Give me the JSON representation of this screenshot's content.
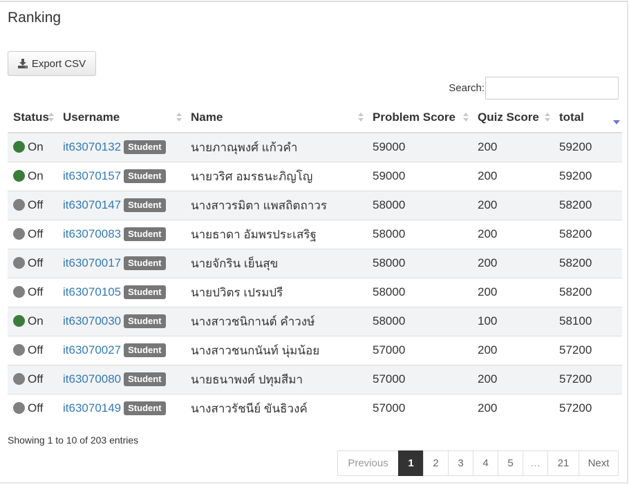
{
  "page": {
    "title": "Ranking",
    "export_label": "Export CSV",
    "search_label": "Search:",
    "search_value": "",
    "info": "Showing 1 to 10 of 203 entries"
  },
  "columns": [
    "Status",
    "Username",
    "Name",
    "Problem Score",
    "Quiz Score",
    "total"
  ],
  "colors": {
    "online": "#3a7d3a",
    "offline": "#808080",
    "link": "#337ab7",
    "badge": "#777777",
    "active_page": "#333333"
  },
  "rows": [
    {
      "status": "On",
      "online": true,
      "username": "it63070132",
      "role": "Student",
      "name": "นายภาณุพงศ์ แก้วคำ",
      "problem": "59000",
      "quiz": "200",
      "total": "59200"
    },
    {
      "status": "On",
      "online": true,
      "username": "it63070157",
      "role": "Student",
      "name": "นายวริศ อมรธนะภิญโญ",
      "problem": "59000",
      "quiz": "200",
      "total": "59200"
    },
    {
      "status": "Off",
      "online": false,
      "username": "it63070147",
      "role": "Student",
      "name": "นางสาวรมิตา แพสถิตถาวร",
      "problem": "58000",
      "quiz": "200",
      "total": "58200"
    },
    {
      "status": "Off",
      "online": false,
      "username": "it63070083",
      "role": "Student",
      "name": "นายธาดา อัมพรประเสริฐ",
      "problem": "58000",
      "quiz": "200",
      "total": "58200"
    },
    {
      "status": "Off",
      "online": false,
      "username": "it63070017",
      "role": "Student",
      "name": "นายจักริน เย็นสุข",
      "problem": "58000",
      "quiz": "200",
      "total": "58200"
    },
    {
      "status": "Off",
      "online": false,
      "username": "it63070105",
      "role": "Student",
      "name": "นายปวิตร เปรมปรี",
      "problem": "58000",
      "quiz": "200",
      "total": "58200"
    },
    {
      "status": "On",
      "online": true,
      "username": "it63070030",
      "role": "Student",
      "name": "นางสาวชนิกานต์ คำวงษ์",
      "problem": "58000",
      "quiz": "100",
      "total": "58100"
    },
    {
      "status": "Off",
      "online": false,
      "username": "it63070027",
      "role": "Student",
      "name": "นางสาวชนกนันท์ นุ่มน้อย",
      "problem": "57000",
      "quiz": "200",
      "total": "57200"
    },
    {
      "status": "Off",
      "online": false,
      "username": "it63070080",
      "role": "Student",
      "name": "นายธนาพงศ์ ปทุมสีมา",
      "problem": "57000",
      "quiz": "200",
      "total": "57200"
    },
    {
      "status": "Off",
      "online": false,
      "username": "it63070149",
      "role": "Student",
      "name": "นางสาวรัชนีย์ ขันธิวงค์",
      "problem": "57000",
      "quiz": "200",
      "total": "57200"
    }
  ],
  "pagination": {
    "previous": "Previous",
    "pages": [
      "1",
      "2",
      "3",
      "4",
      "5",
      "…",
      "21"
    ],
    "active": "1",
    "next": "Next"
  },
  "icons": {
    "export": "download-icon",
    "sort": "sort-icon",
    "sort_active": "sort-desc-icon"
  }
}
